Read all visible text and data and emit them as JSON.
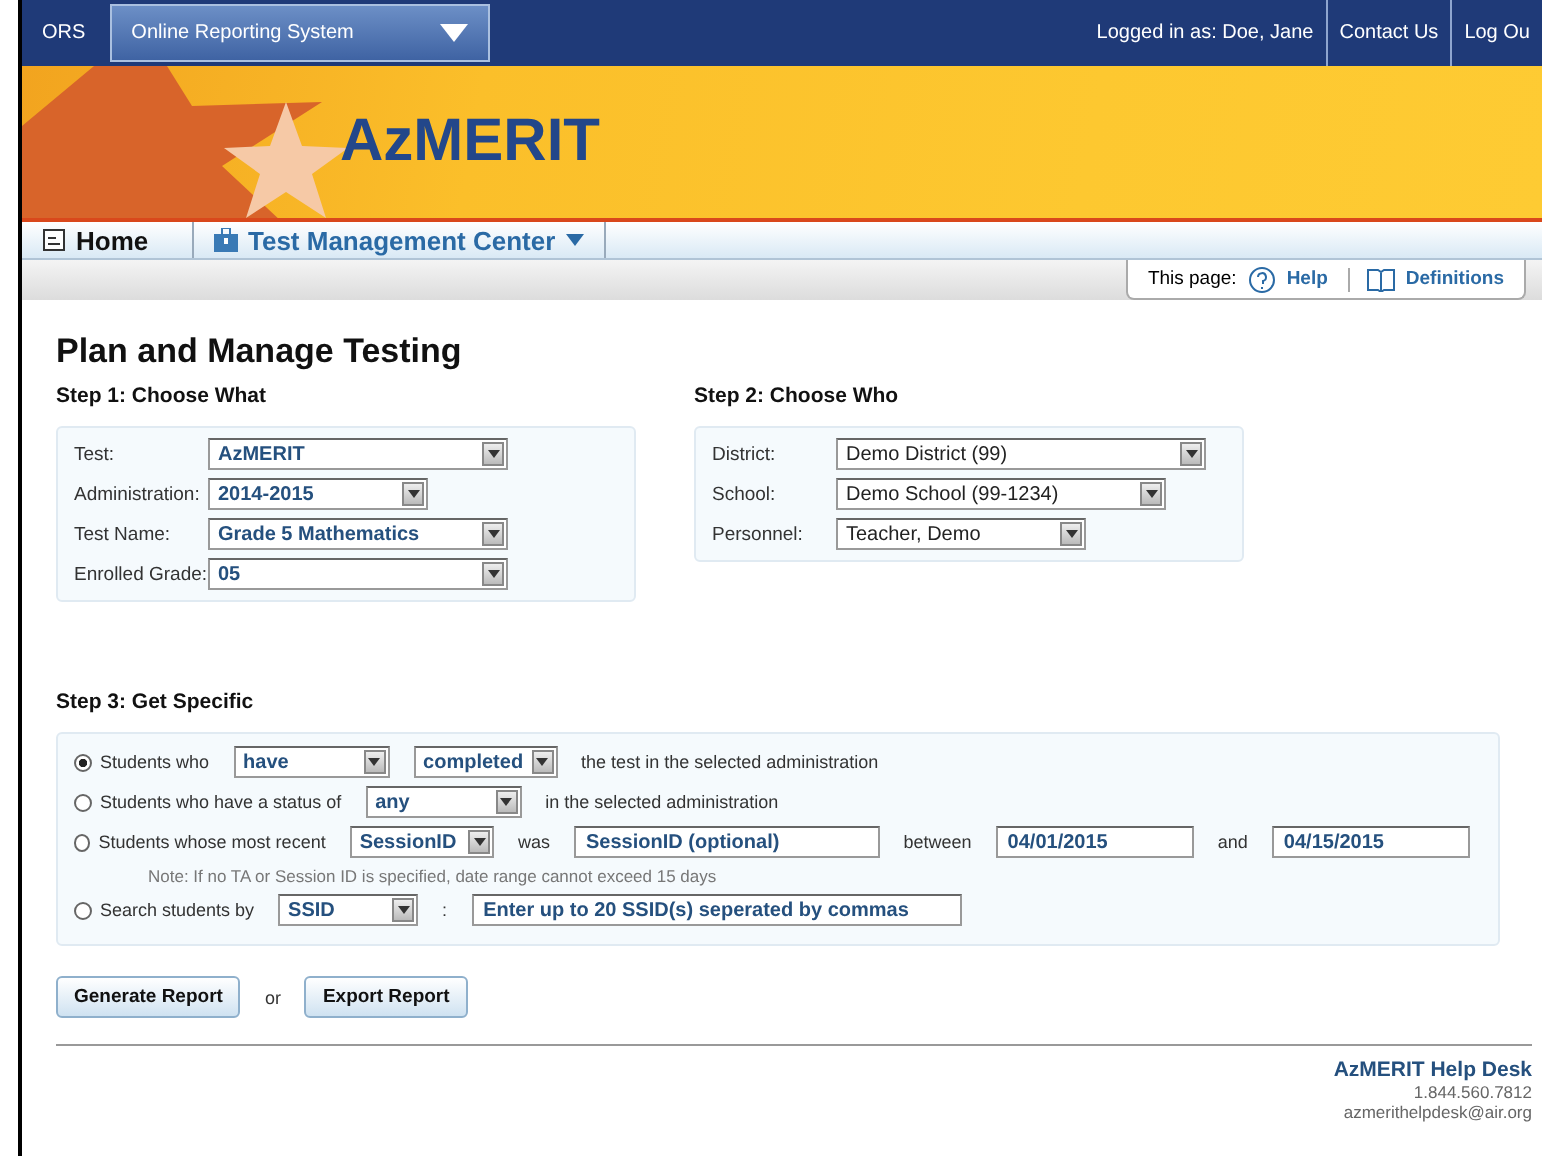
{
  "top_bar": {
    "app_label": "ORS",
    "system_menu": "Online Reporting System",
    "logged_in": "Logged in as: Doe, Jane",
    "links": [
      "Contact Us",
      "Log Ou"
    ]
  },
  "banner": {
    "logo": "AzMERIT"
  },
  "nav": {
    "items": [
      {
        "label": "Home",
        "selected": true,
        "has_menu": false
      },
      {
        "label": "Test Management Center",
        "selected": false,
        "has_menu": true
      }
    ]
  },
  "page_tools": {
    "label": "This page:",
    "links": [
      "Help",
      "Definitions"
    ]
  },
  "title": "Plan and Manage Testing",
  "step1": {
    "heading": "Step 1: Choose What",
    "fields": [
      {
        "label": "Test:",
        "value": "AzMERIT"
      },
      {
        "label": "Administration:",
        "value": "2014-2015"
      },
      {
        "label": "Test Name:",
        "value": "Grade 5 Mathematics"
      },
      {
        "label": "Enrolled Grade:",
        "value": "05"
      }
    ]
  },
  "step2": {
    "heading": "Step 2: Choose Who",
    "fields": [
      {
        "label": "District:",
        "value": "Demo District (99)"
      },
      {
        "label": "School:",
        "value": "Demo School (99-1234)"
      },
      {
        "label": "Personnel:",
        "value": "Teacher, Demo"
      }
    ]
  },
  "step3": {
    "heading": "Step 3: Get Specific",
    "rows": [
      {
        "selected": true,
        "parts": [
          {
            "kind": "text",
            "text": "Students who"
          },
          {
            "kind": "select",
            "value": "have"
          },
          {
            "kind": "select",
            "value": "completed"
          },
          {
            "kind": "text",
            "text": "the test in the selected administration"
          }
        ]
      },
      {
        "selected": false,
        "parts": [
          {
            "kind": "text",
            "text": "Students who have a status of"
          },
          {
            "kind": "select",
            "value": "any"
          },
          {
            "kind": "text",
            "text": "in the selected administration"
          }
        ]
      },
      {
        "selected": false,
        "parts": [
          {
            "kind": "text",
            "text": "Students whose most recent"
          },
          {
            "kind": "select",
            "value": "SessionID"
          },
          {
            "kind": "text",
            "text": "was"
          },
          {
            "kind": "input",
            "value": "SessionID (optional)"
          },
          {
            "kind": "text",
            "text": "between"
          },
          {
            "kind": "input",
            "value": "04/01/2015"
          },
          {
            "kind": "text",
            "text": "and"
          },
          {
            "kind": "input",
            "value": "04/15/2015"
          }
        ],
        "note": "Note: If no TA or Session ID is specified, date range cannot exceed 15 days"
      },
      {
        "selected": false,
        "parts": [
          {
            "kind": "text",
            "text": "Search students by"
          },
          {
            "kind": "select",
            "value": "SSID"
          },
          {
            "kind": "text",
            "text": ":"
          },
          {
            "kind": "input",
            "value": "Enter up to 20 SSID(s) seperated by commas"
          }
        ]
      }
    ]
  },
  "actions": {
    "buttons": [
      "Generate Report",
      "Export Report"
    ],
    "separator": "or"
  },
  "help_desk": {
    "title": "AzMERIT Help Desk",
    "phone": "1.844.560.7812",
    "email": "azmerithelpdesk@air.org"
  }
}
